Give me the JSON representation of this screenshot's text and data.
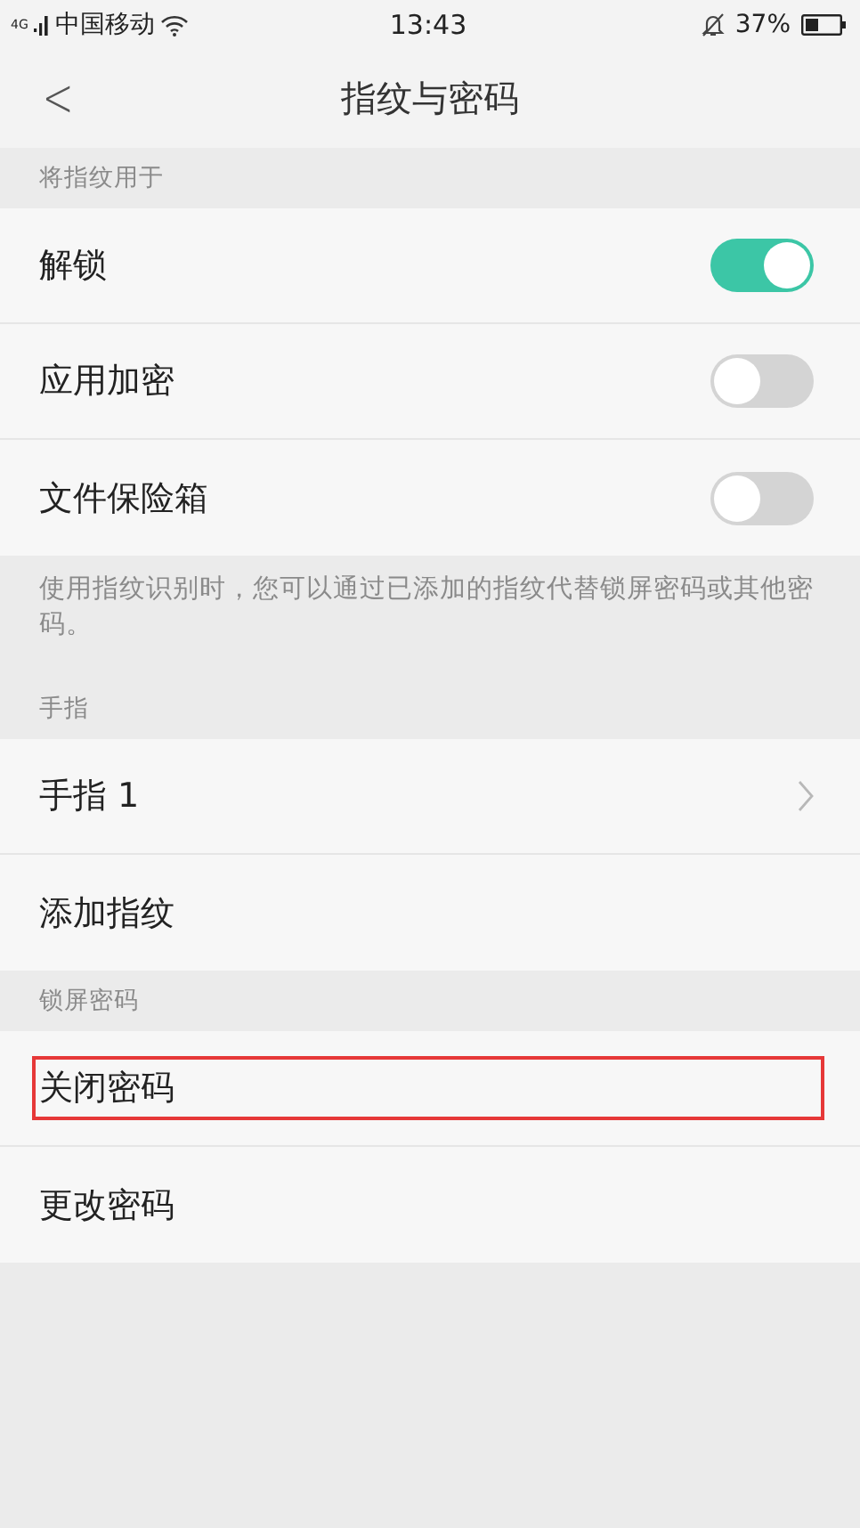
{
  "status_bar": {
    "network": "4G",
    "carrier": "中国移动",
    "time": "13:43",
    "battery": "37%"
  },
  "nav": {
    "back": "<",
    "title": "指纹与密码"
  },
  "sections": [
    {
      "header": "将指纹用于",
      "items": [
        {
          "kind": "toggle",
          "label": "解锁",
          "on": true
        },
        {
          "kind": "toggle",
          "label": "应用加密",
          "on": false
        },
        {
          "kind": "toggle",
          "label": "文件保险箱",
          "on": false
        }
      ],
      "note": "使用指纹识别时，您可以通过已添加的指纹代替锁屏密码或其他密码。"
    },
    {
      "header": "手指",
      "items": [
        {
          "kind": "link",
          "label": "手指 1"
        },
        {
          "kind": "plain",
          "label": "添加指纹"
        }
      ]
    },
    {
      "header": "锁屏密码",
      "items": [
        {
          "kind": "plain",
          "label": "关闭密码",
          "highlighted": true
        },
        {
          "kind": "plain",
          "label": "更改密码",
          "highlighted": false
        }
      ]
    }
  ]
}
